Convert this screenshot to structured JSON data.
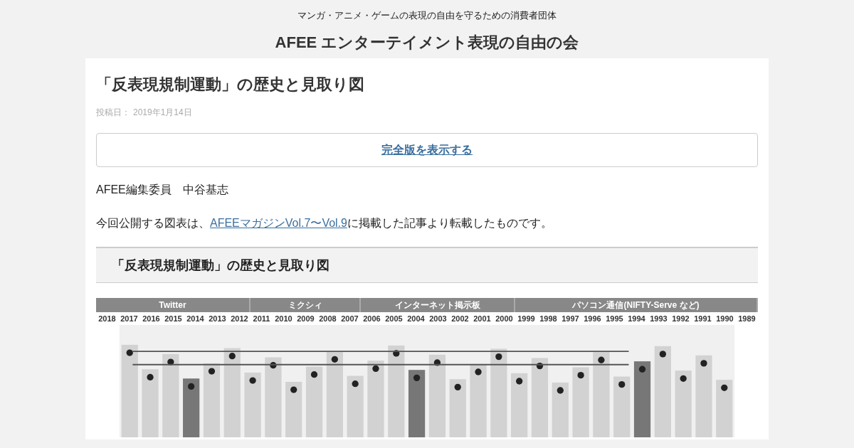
{
  "site": {
    "tagline": "マンガ・アニメ・ゲームの表現の自由を守るための消費者団体",
    "title": "AFEE エンターテイメント表現の自由の会"
  },
  "article": {
    "title": "「反表現規制運動」の歴史と見取り図",
    "date_label": "投稿日：",
    "date": "2019年1月14日",
    "full_version_link": "完全版を表示する",
    "author": "AFEE編集委員　中谷基志",
    "intro": {
      "before": "今回公開する図表は、",
      "link": "AFEEマガジンVol.7〜Vol.9",
      "after": "に掲載した記事より転載したものです。"
    },
    "section_heading": "「反表現規制運動」の歴史と見取り図",
    "figure": {
      "eras": [
        {
          "label": "Twitter"
        },
        {
          "label": "ミクシィ"
        },
        {
          "label": "インターネット掲示板"
        },
        {
          "label": "パソコン通信(NIFTY-Serve など)"
        }
      ],
      "years": [
        "2018",
        "2017",
        "2016",
        "2015",
        "2014",
        "2013",
        "2012",
        "2011",
        "2010",
        "2009",
        "2008",
        "2007",
        "2006",
        "2005",
        "2004",
        "2003",
        "2002",
        "2001",
        "2000",
        "1999",
        "1998",
        "1997",
        "1996",
        "1995",
        "1994",
        "1993",
        "1992",
        "1991",
        "1990",
        "1989"
      ]
    }
  }
}
